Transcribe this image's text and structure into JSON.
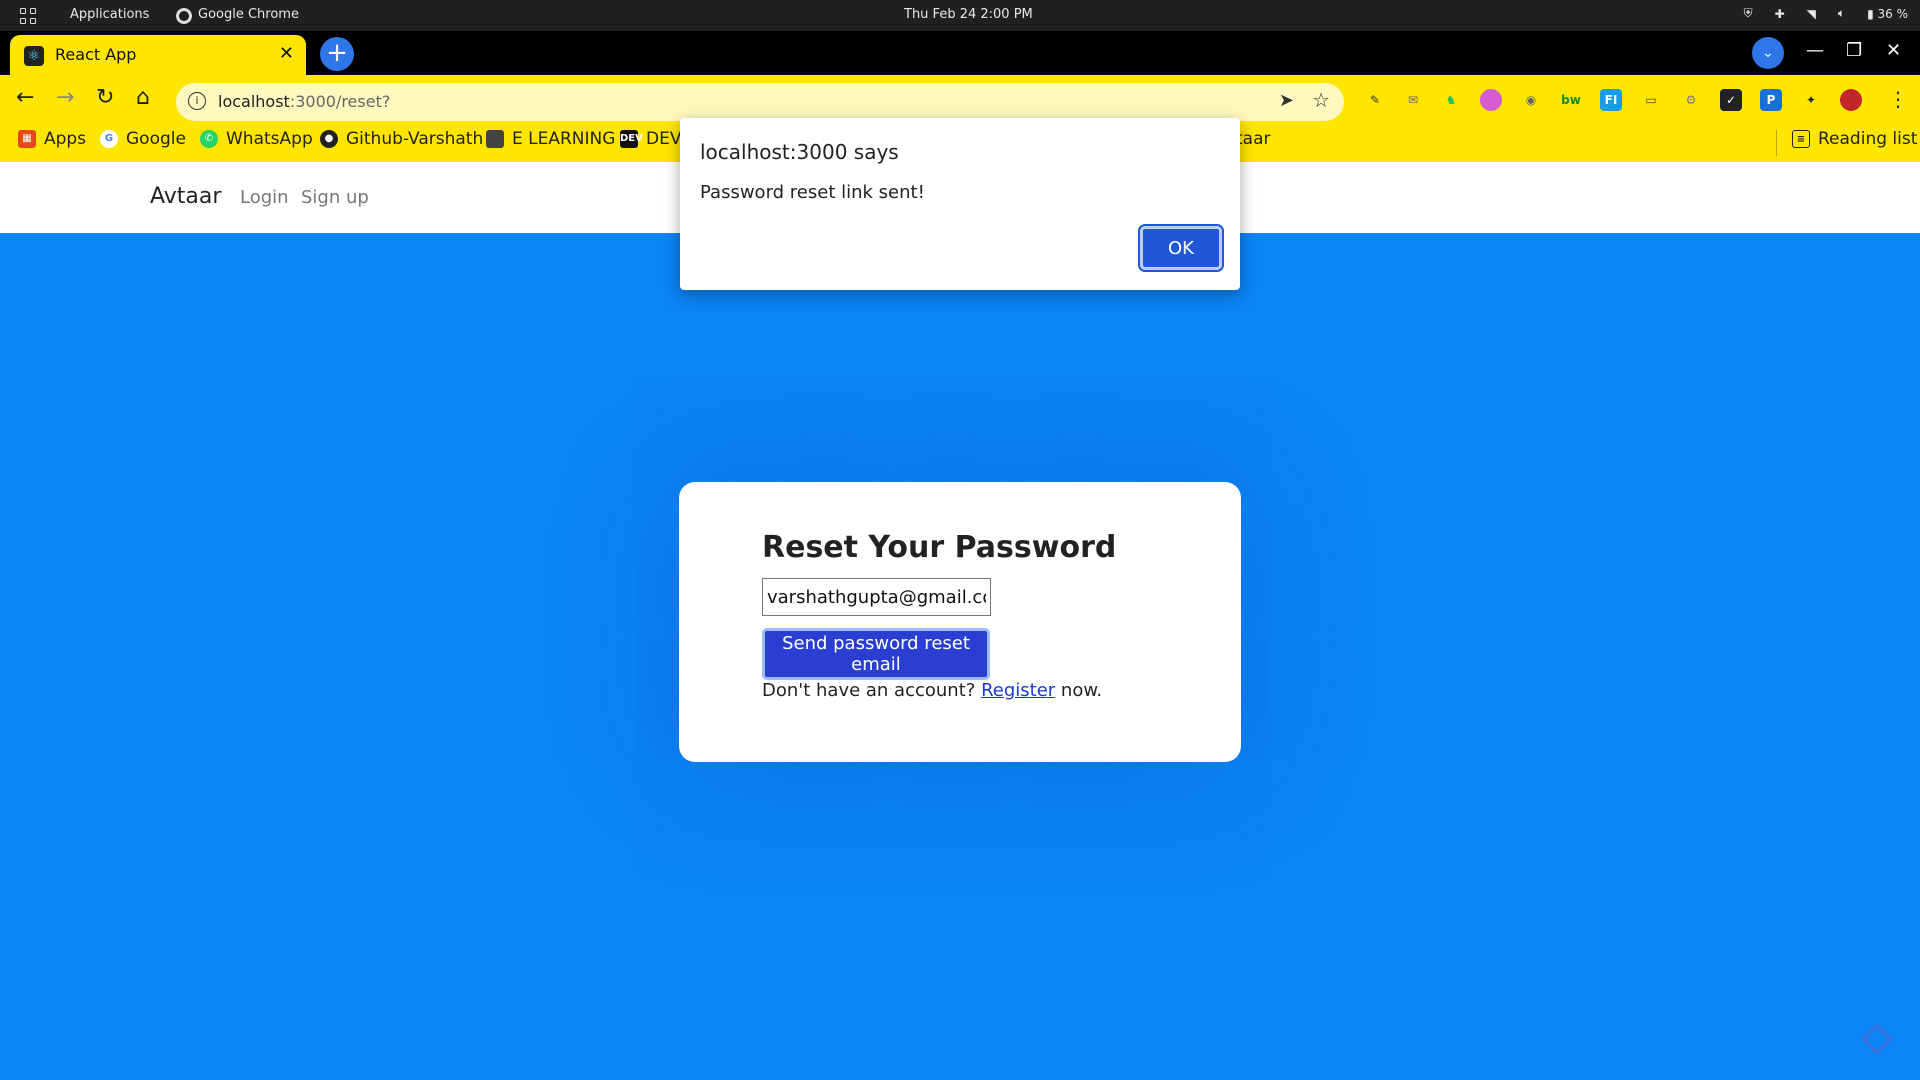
{
  "system_bar": {
    "applications": "Applications",
    "active_app": "Google Chrome",
    "clock": "Thu Feb 24   2:00 PM",
    "battery": "36 %"
  },
  "browser": {
    "tab_title": "React App",
    "url_host": "localhost",
    "url_path": ":3000/reset?",
    "bookmarks": [
      {
        "label": "Apps",
        "icon": "apps-grid-icon"
      },
      {
        "label": "Google",
        "icon": "google-icon"
      },
      {
        "label": "WhatsApp",
        "icon": "whatsapp-icon"
      },
      {
        "label": "Github-Varshath",
        "icon": "github-icon"
      },
      {
        "label": "E LEARNING",
        "icon": "folder-icon"
      },
      {
        "label": "DEV",
        "icon": "dev-icon"
      },
      {
        "label": "taar",
        "icon": ""
      }
    ],
    "reading_list": "Reading list"
  },
  "navbar": {
    "brand": "Avtaar",
    "links": [
      "Login",
      "Sign up"
    ]
  },
  "reset_form": {
    "title": "Reset Your Password",
    "email_value": "varshathgupta@gmail.com",
    "submit_label": "Send password reset email",
    "footer_prefix": "Don't have an account?",
    "register_link": "Register",
    "footer_suffix": "now."
  },
  "alert": {
    "title": "localhost:3000 says",
    "message": "Password reset link sent!",
    "ok_label": "OK"
  },
  "colors": {
    "page_bg": "#0b84f5",
    "theme_yellow": "#ffe600",
    "button_blue": "#2a3fd1"
  }
}
